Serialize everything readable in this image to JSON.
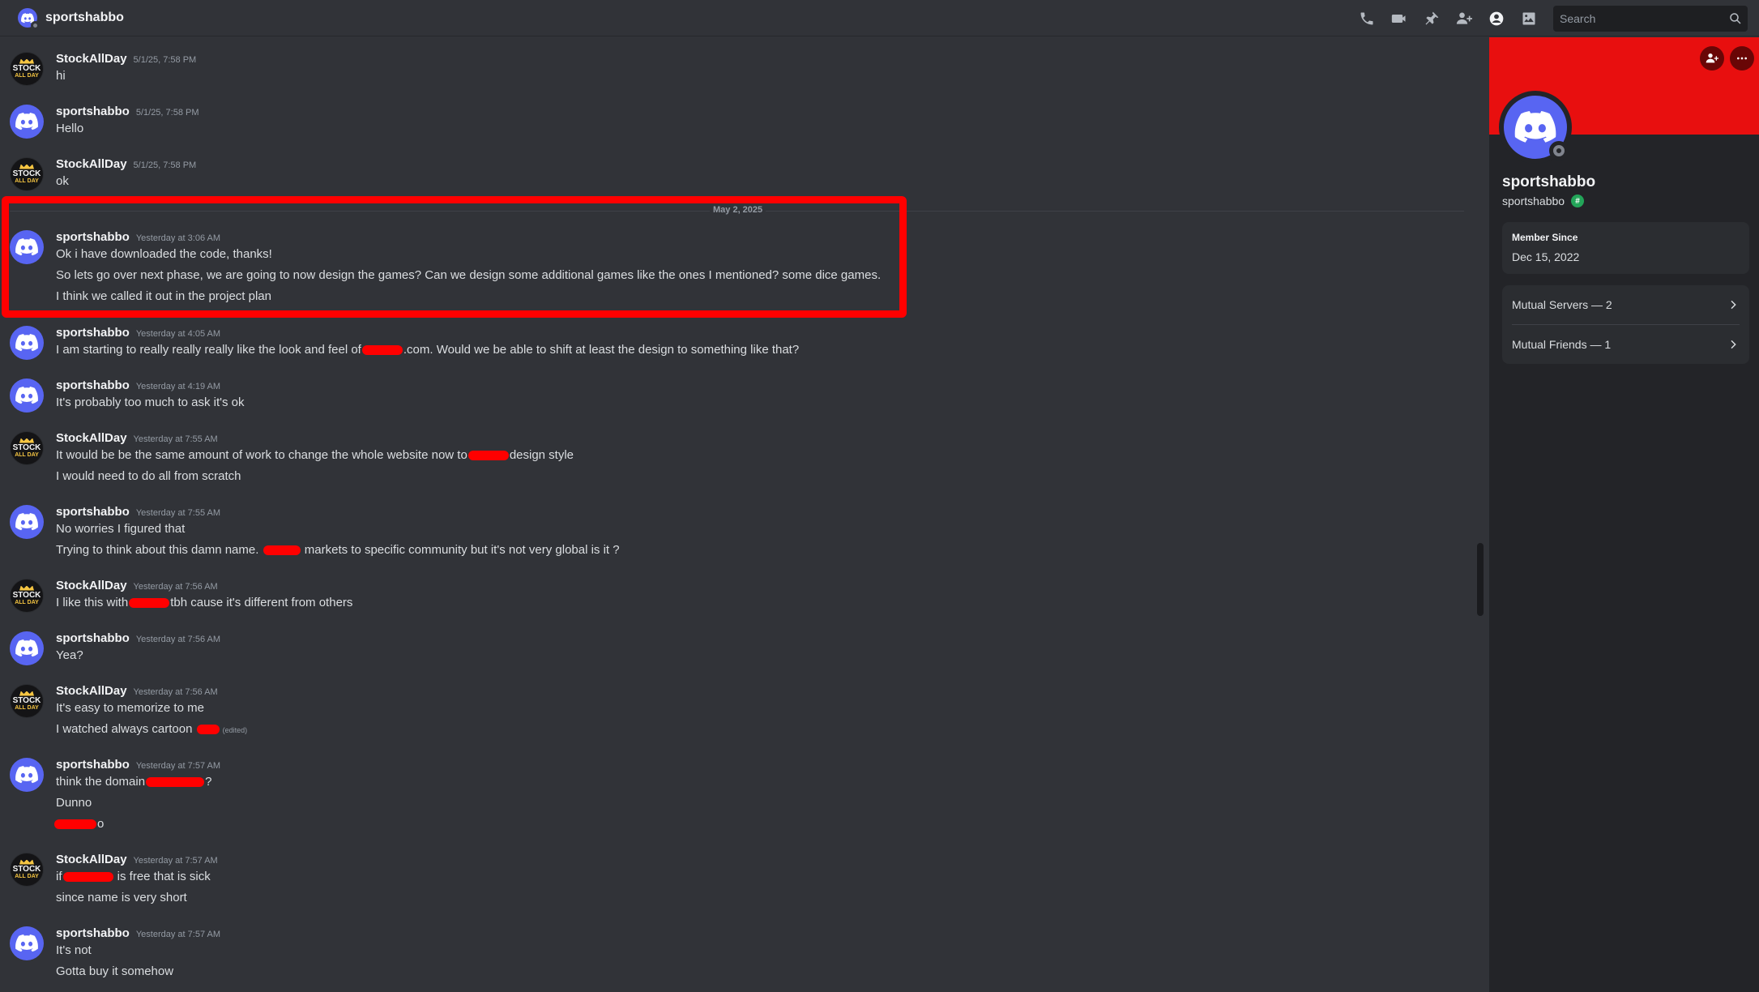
{
  "header": {
    "channel_name": "sportshabbo",
    "icons": [
      "phone-icon",
      "video-icon",
      "pin-icon",
      "add-friend-icon",
      "profile-toggle-icon",
      "gallery-icon"
    ],
    "search_placeholder": "Search"
  },
  "chat": {
    "date_divider": "May 2, 2025",
    "messages": [
      {
        "author": "StockAllDay",
        "avatar": "stock",
        "timestamp": "5/1/25, 7:58 PM",
        "lines": [
          "hi"
        ]
      },
      {
        "author": "sportshabbo",
        "avatar": "discord",
        "timestamp": "5/1/25, 7:58 PM",
        "lines": [
          "Hello"
        ]
      },
      {
        "author": "StockAllDay",
        "avatar": "stock",
        "timestamp": "5/1/25, 7:58 PM",
        "lines": [
          "ok"
        ]
      },
      {
        "author": "sportshabbo",
        "avatar": "discord",
        "timestamp": "Yesterday at 3:06 AM",
        "lines": [
          "Ok i have downloaded the code, thanks!",
          "So lets go over next phase, we are going to now design the games? Can we design some additional games like the ones I mentioned? some dice games.",
          "I think we called it out in the project plan"
        ]
      },
      {
        "author": "sportshabbo",
        "avatar": "discord",
        "timestamp": "Yesterday at 4:05 AM",
        "lines": [
          {
            "before": "I am starting to really really really like the look and feel of",
            "after": ".com. Would we be able to shift at least the design to something like that?"
          }
        ]
      },
      {
        "author": "sportshabbo",
        "avatar": "discord",
        "timestamp": "Yesterday at 4:19 AM",
        "lines": [
          "It's probably too much to ask it's ok"
        ]
      },
      {
        "author": "StockAllDay",
        "avatar": "stock",
        "timestamp": "Yesterday at 7:55 AM",
        "lines": [
          {
            "before": "It would be be the same amount of work to change the whole website now to",
            "after": "design style"
          },
          "I would need to do all from scratch"
        ]
      },
      {
        "author": "sportshabbo",
        "avatar": "discord",
        "timestamp": "Yesterday at 7:55 AM",
        "lines": [
          "No worries I figured that",
          {
            "before": "Trying to think about this damn name.",
            "after": "markets to specific community but it's not very global is it ?"
          }
        ]
      },
      {
        "author": "StockAllDay",
        "avatar": "stock",
        "timestamp": "Yesterday at 7:56 AM",
        "lines": [
          {
            "before": "I like this with",
            "after": "tbh cause it's different from others"
          }
        ]
      },
      {
        "author": "sportshabbo",
        "avatar": "discord",
        "timestamp": "Yesterday at 7:56 AM",
        "lines": [
          "Yea?"
        ]
      },
      {
        "author": "StockAllDay",
        "avatar": "stock",
        "timestamp": "Yesterday at 7:56 AM",
        "lines": [
          "It's easy to memorize to me",
          {
            "before": "I watched always cartoon",
            "after": "",
            "edited": "(edited)"
          }
        ]
      },
      {
        "author": "sportshabbo",
        "avatar": "discord",
        "timestamp": "Yesterday at 7:57 AM",
        "lines": [
          {
            "before": "think the domain",
            "after": "?"
          },
          "Dunno",
          {
            "before": "",
            "after": "o"
          }
        ]
      },
      {
        "author": "StockAllDay",
        "avatar": "stock",
        "timestamp": "Yesterday at 7:57 AM",
        "lines": [
          {
            "before": "if",
            "after": "is free that is sick"
          },
          "since name is very short"
        ]
      },
      {
        "author": "sportshabbo",
        "avatar": "discord",
        "timestamp": "Yesterday at 7:57 AM",
        "lines": [
          "It's not",
          "Gotta buy it somehow"
        ]
      }
    ]
  },
  "profile": {
    "display_name": "sportshabbo",
    "username": "sportshabbo",
    "badge": "#",
    "member_since_label": "Member Since",
    "member_since_value": "Dec 15, 2022",
    "mutual_servers": "Mutual Servers — 2",
    "mutual_friends": "Mutual Friends — 1",
    "banner_color": "#e80f0f"
  },
  "colors": {
    "background": "#313338",
    "panel": "#232428",
    "accent": "#5865f2",
    "highlight": "#ff0000"
  }
}
